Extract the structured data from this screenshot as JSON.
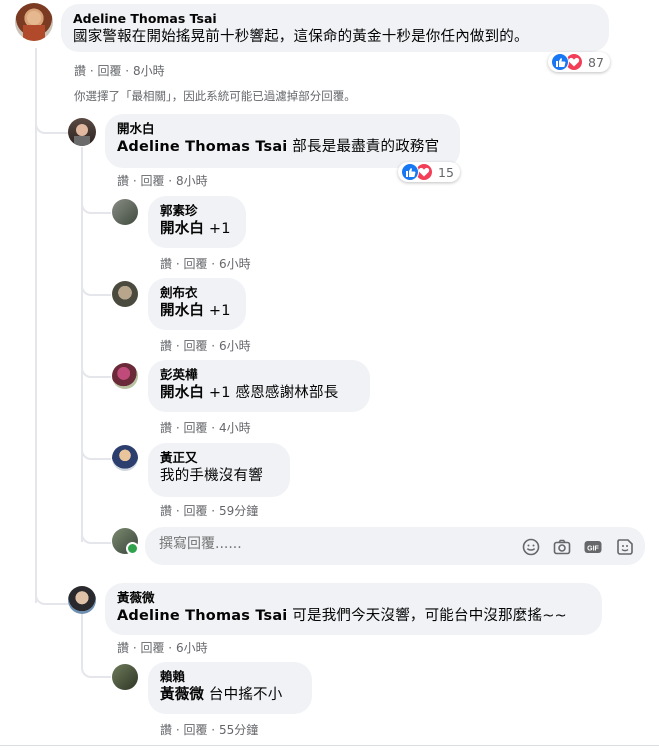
{
  "comment_main": {
    "author": "Adeline Thomas Tsai",
    "text": "國家警報在開始搖晃前十秒響起，這保命的黃金十秒是你任內做到的。",
    "like": "讚",
    "reply": "回覆",
    "time": "8小時",
    "reactions": "87"
  },
  "filter_notice": "你選擇了「最相關」，因此系統可能已過濾掉部分回覆。",
  "comment_1": {
    "author": "開水白",
    "mention": "Adeline Thomas Tsai",
    "text": "部長是最盡責的政務官",
    "like": "讚",
    "reply": "回覆",
    "time": "8小時",
    "reactions": "15"
  },
  "replies_1": [
    {
      "author": "郭素珍",
      "mention": "開水白",
      "text": "+1",
      "like": "讚",
      "reply": "回覆",
      "time": "6小時"
    },
    {
      "author": "劍布衣",
      "mention": "開水白",
      "text": "+1",
      "like": "讚",
      "reply": "回覆",
      "time": "6小時"
    },
    {
      "author": "彭英樺",
      "mention": "開水白",
      "text": "+1 感恩感謝林部長",
      "like": "讚",
      "reply": "回覆",
      "time": "4小時"
    },
    {
      "author": "黃正又",
      "mention": "",
      "text": "我的手機沒有響",
      "like": "讚",
      "reply": "回覆",
      "time": "59分鐘"
    }
  ],
  "reply_input": {
    "placeholder": "撰寫回覆......"
  },
  "comment_2": {
    "author": "黃薇微",
    "mention": "Adeline Thomas Tsai",
    "text": "可是我們今天沒響，可能台中沒那麼搖~~",
    "like": "讚",
    "reply": "回覆",
    "time": "6小時"
  },
  "replies_2": [
    {
      "author": "賴賴",
      "mention": "黃薇微",
      "text": "台中搖不小",
      "like": "讚",
      "reply": "回覆",
      "time": "55分鐘"
    }
  ],
  "icons": [
    "emoji-icon",
    "camera-icon",
    "gif-icon",
    "sticker-icon",
    "like-reaction-icon",
    "love-reaction-icon"
  ],
  "colors": {
    "bubble": "#f0f2f5",
    "meta": "#65676b",
    "like": "#1877f2",
    "love": "#f33e58",
    "thread_line": "#e4e6eb",
    "online": "#31a24c"
  }
}
